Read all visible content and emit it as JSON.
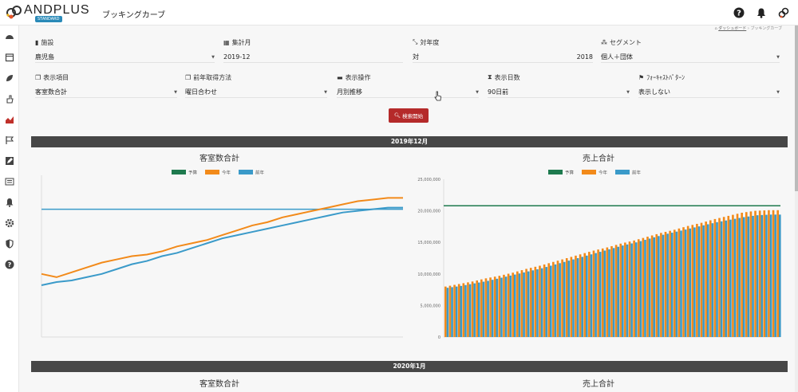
{
  "header": {
    "brand": "ANDPLUS",
    "badge": "STANDARD",
    "title": "ブッキングカーブ",
    "icons": [
      "question-icon",
      "bell-icon",
      "link-icon"
    ]
  },
  "breadcrumb": {
    "home": "ダッシュボード",
    "sep": "›",
    "current": "ブッキングカーブ"
  },
  "sidebar": {
    "icons": [
      "dashboard-icon",
      "calendar-icon",
      "leaf-icon",
      "hand-icon",
      "area-chart-icon",
      "flag-icon",
      "edit-icon",
      "list-icon",
      "bell-icon",
      "gear-icon",
      "shield-icon",
      "question-icon"
    ]
  },
  "filters": {
    "facility": {
      "label": "施設",
      "value": "鹿児島"
    },
    "month": {
      "label": "集計月",
      "value": "2019-12"
    },
    "year": {
      "label": "対年度",
      "prefix": "対",
      "value": "2018"
    },
    "segment": {
      "label": "セグメント",
      "value": "個人＋団体"
    },
    "item": {
      "label": "表示項目",
      "value": "客室数合計"
    },
    "prevyear": {
      "label": "前年取得方法",
      "value": "曜日合わせ"
    },
    "operation": {
      "label": "表示操作",
      "value": "月別推移"
    },
    "days": {
      "label": "表示日数",
      "value": "90日前"
    },
    "forecast": {
      "label": "ﾌｫｰｷｬｽﾄﾊﾟﾀｰﾝ",
      "value": "表示しない"
    }
  },
  "search_button": "検索開始",
  "sections": [
    {
      "banner": "2019年12月",
      "left_title": "客室数合計",
      "right_title": "売上合計"
    },
    {
      "banner": "2020年1月",
      "left_title": "客室数合計",
      "right_title": "売上合計"
    }
  ],
  "legend": [
    "予算",
    "今年",
    "前年"
  ],
  "colors": {
    "budget": "#1e7a4e",
    "this_year": "#f28a1a",
    "last_year": "#3a9ac9",
    "banner": "#474747",
    "button": "#b52a2a"
  },
  "chart_data": [
    {
      "type": "line",
      "title": "客室数合計",
      "series": [
        {
          "name": "予算",
          "values": [
            0.79
          ]
        },
        {
          "name": "今年",
          "values": [
            0.39,
            0.37,
            0.4,
            0.43,
            0.46,
            0.48,
            0.5,
            0.51,
            0.53,
            0.56,
            0.58,
            0.6,
            0.63,
            0.66,
            0.69,
            0.71,
            0.74,
            0.76,
            0.78,
            0.8,
            0.82,
            0.84,
            0.85,
            0.86,
            0.86
          ]
        },
        {
          "name": "前年",
          "values": [
            0.32,
            0.34,
            0.35,
            0.37,
            0.39,
            0.42,
            0.45,
            0.47,
            0.5,
            0.52,
            0.55,
            0.58,
            0.61,
            0.63,
            0.65,
            0.67,
            0.69,
            0.71,
            0.73,
            0.75,
            0.77,
            0.78,
            0.79,
            0.8,
            0.8
          ]
        }
      ]
    },
    {
      "type": "bar",
      "title": "売上合計",
      "ylim": [
        0,
        25000000
      ],
      "yticks": [
        "25,000,000",
        "20,000,000",
        "15,000,000",
        "10,000,000",
        "5,000,000",
        "0"
      ],
      "budget": 20800000,
      "series": [
        {
          "name": "今年",
          "values": [
            8000000,
            8400000,
            8800000,
            9300000,
            9700000,
            10200000,
            10800000,
            11300000,
            11900000,
            12500000,
            13100000,
            13700000,
            14200000,
            14800000,
            15300000,
            15900000,
            16500000,
            17000000,
            17600000,
            18100000,
            18700000,
            19200000,
            19700000,
            20000000,
            20100000
          ]
        },
        {
          "name": "前年",
          "values": [
            7800000,
            8100000,
            8500000,
            8900000,
            9400000,
            9900000,
            10400000,
            10900000,
            11500000,
            12100000,
            12700000,
            13300000,
            13900000,
            14500000,
            15000000,
            15600000,
            16200000,
            16700000,
            17200000,
            17700000,
            18200000,
            18600000,
            19000000,
            19300000,
            19400000
          ]
        }
      ]
    }
  ]
}
